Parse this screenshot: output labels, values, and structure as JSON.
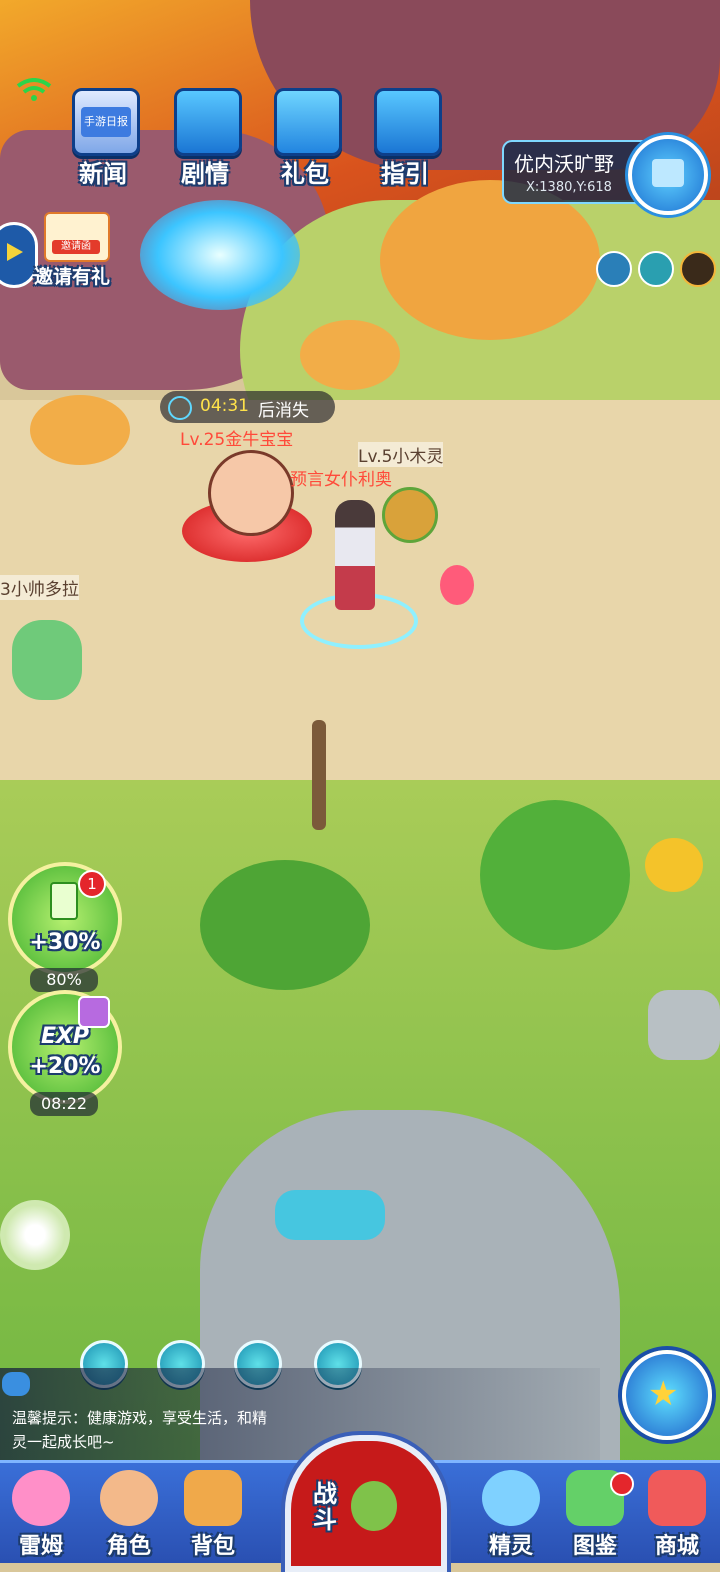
{
  "hud": {
    "wifi_icon": "wifi-icon",
    "top_buttons": [
      {
        "label": "新闻",
        "icon": "news-tv-icon",
        "screen_text": "手游日报"
      },
      {
        "label": "剧情",
        "icon": "story-chest-icon"
      },
      {
        "label": "礼包",
        "icon": "gift-box-icon"
      },
      {
        "label": "指引",
        "icon": "guide-chest-icon"
      }
    ],
    "invite": {
      "label": "邀请有礼",
      "badge": "邀请函"
    },
    "location": {
      "name": "优内沃旷野",
      "coords": "X:1380,Y:618"
    },
    "timer": {
      "time": "04:31",
      "suffix": "后消失"
    }
  },
  "world": {
    "boss_name": "Lv.25金牛宝宝",
    "npc_name": "预言女仆利奥",
    "pet_name": "Lv.5小木灵",
    "player_name": "3小帅多拉"
  },
  "buffs": {
    "energy": {
      "value": "+30%",
      "count": "1",
      "percent": "80%"
    },
    "exp": {
      "title": "EXP",
      "value": "+20%",
      "time": "08:22"
    }
  },
  "chat": {
    "text": "温馨提示：健康游戏，享受生活，和精灵一起成长吧~"
  },
  "bottom_nav": {
    "items": [
      {
        "label": "雷姆",
        "color": "#ff8fc8"
      },
      {
        "label": "角色",
        "color": "#f3b98a"
      },
      {
        "label": "背包",
        "color": "#f0a94a"
      },
      {
        "label": "精灵",
        "color": "#7fd1ff"
      },
      {
        "label": "图鉴",
        "color": "#64d068"
      },
      {
        "label": "商城",
        "color": "#f05a5a"
      }
    ],
    "battle": "战斗"
  }
}
